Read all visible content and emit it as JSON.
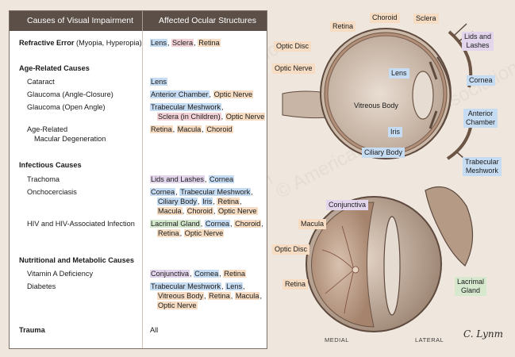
{
  "table": {
    "header": {
      "col1": "Causes of Visual Impairment",
      "col2": "Affected Ocular Structures"
    },
    "rows": {
      "refractive": {
        "label_bold": "Refractive Error",
        "label_rest": " (Myopia, Hyperopia)",
        "structures": [
          "Lens",
          "Sclera",
          "Retina"
        ]
      },
      "age_related": {
        "heading": "Age-Related Causes",
        "cataract": {
          "label": "Cataract",
          "structures": [
            "Lens"
          ]
        },
        "glaucoma_closure": {
          "label": "Glaucoma (Angle-Closure)",
          "structures": [
            "Anterior Chamber",
            "Optic Nerve"
          ]
        },
        "glaucoma_open": {
          "label": "Glaucoma (Open Angle)",
          "structures": [
            "Trabecular Meshwork",
            "Sclera (in Children)",
            "Optic Nerve"
          ]
        },
        "amd": {
          "label_line1": "Age-Related",
          "label_line2": "Macular Degeneration",
          "structures": [
            "Retina",
            "Macula",
            "Choroid"
          ]
        }
      },
      "infectious": {
        "heading": "Infectious Causes",
        "trachoma": {
          "label": "Trachoma",
          "structures": [
            "Lids and Lashes",
            "Cornea"
          ]
        },
        "onchocerciasis": {
          "label": "Onchocerciasis",
          "structures": [
            "Cornea",
            "Trabecular Meshwork",
            "Ciliary Body",
            "Iris",
            "Retina",
            "Macula",
            "Choroid",
            "Optic Nerve"
          ]
        },
        "hiv": {
          "label": "HIV and HIV-Associated Infection",
          "structures": [
            "Lacrimal Gland",
            "Cornea",
            "Choroid",
            "Retina",
            "Optic Nerve"
          ]
        }
      },
      "nutritional": {
        "heading": "Nutritional and Metabolic Causes",
        "vitamin_a": {
          "label": "Vitamin A Deficiency",
          "structures": [
            "Conjunctiva",
            "Cornea",
            "Retina"
          ]
        },
        "diabetes": {
          "label": "Diabetes",
          "structures": [
            "Trabecular Meshwork",
            "Lens",
            "Vitreous Body",
            "Retina",
            "Macula",
            "Optic Nerve"
          ]
        }
      },
      "trauma": {
        "label": "Trauma",
        "structures": "All"
      }
    }
  },
  "illustration": {
    "top_labels": {
      "retina": "Retina",
      "choroid": "Choroid",
      "sclera": "Sclera",
      "lids_line1": "Lids and",
      "lids_line2": "Lashes",
      "optic_disc": "Optic Disc",
      "optic_nerve": "Optic Nerve",
      "lens": "Lens",
      "cornea": "Cornea",
      "vitreous": "Vitreous Body",
      "anterior_line1": "Anterior",
      "anterior_line2": "Chamber",
      "iris": "Iris",
      "ciliary": "Ciliary Body",
      "trabecular_line1": "Trabecular",
      "trabecular_line2": "Meshwork"
    },
    "bottom_labels": {
      "conjunctiva": "Conjunctiva",
      "macula": "Macula",
      "optic_disc": "Optic Disc",
      "retina": "Retina",
      "lacrimal_line1": "Lacrimal",
      "lacrimal_line2": "Gland"
    },
    "orientation": {
      "medial": "MEDIAL",
      "lateral": "LATERAL"
    },
    "signature": "C. Lynm",
    "watermark": "© American Medical Association"
  }
}
